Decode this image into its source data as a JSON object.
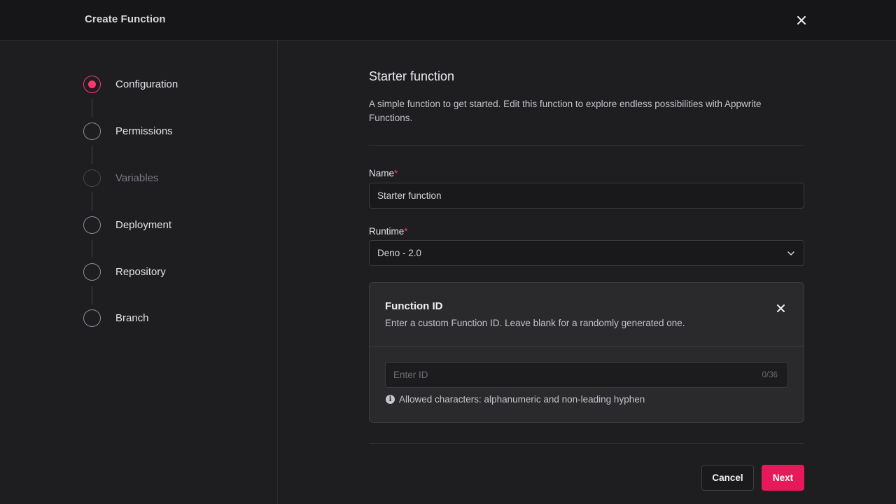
{
  "header": {
    "title": "Create Function",
    "close_icon": "close-icon"
  },
  "steps": [
    {
      "label": "Configuration",
      "state": "active"
    },
    {
      "label": "Permissions",
      "state": "default"
    },
    {
      "label": "Variables",
      "state": "disabled"
    },
    {
      "label": "Deployment",
      "state": "default"
    },
    {
      "label": "Repository",
      "state": "default"
    },
    {
      "label": "Branch",
      "state": "default"
    }
  ],
  "main": {
    "title": "Starter function",
    "description": "A simple function to get started. Edit this function to explore endless possibilities with Appwrite Functions.",
    "name_field": {
      "label": "Name",
      "required_mark": "*",
      "value": "Starter function"
    },
    "runtime_field": {
      "label": "Runtime",
      "required_mark": "*",
      "value": "Deno - 2.0"
    }
  },
  "function_id_card": {
    "title": "Function ID",
    "description": "Enter a custom Function ID. Leave blank for a randomly generated one.",
    "input_placeholder": "Enter ID",
    "input_value": "",
    "counter": "0/36",
    "hint": "Allowed characters: alphanumeric and non-leading hyphen"
  },
  "footer": {
    "cancel_label": "Cancel",
    "next_label": "Next"
  },
  "colors": {
    "accent": "#fd366e",
    "primary_button": "#e8195a"
  }
}
